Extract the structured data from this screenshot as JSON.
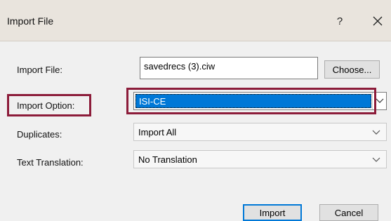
{
  "window": {
    "title": "Import File",
    "help_label": "?",
    "close_icon": "close-icon"
  },
  "form": {
    "import_file_label": "Import File:",
    "import_file_value": "savedrecs (3).ciw",
    "choose_label": "Choose...",
    "import_option_label": "Import Option:",
    "import_option_value": "ISI-CE",
    "duplicates_label": "Duplicates:",
    "duplicates_value": "Import All",
    "text_translation_label": "Text Translation:",
    "text_translation_value": "No Translation"
  },
  "buttons": {
    "import_label": "Import",
    "cancel_label": "Cancel"
  },
  "colors": {
    "titlebar": "#e9e4dd",
    "selection": "#0078d7",
    "highlight_box": "#8c1c3a"
  }
}
